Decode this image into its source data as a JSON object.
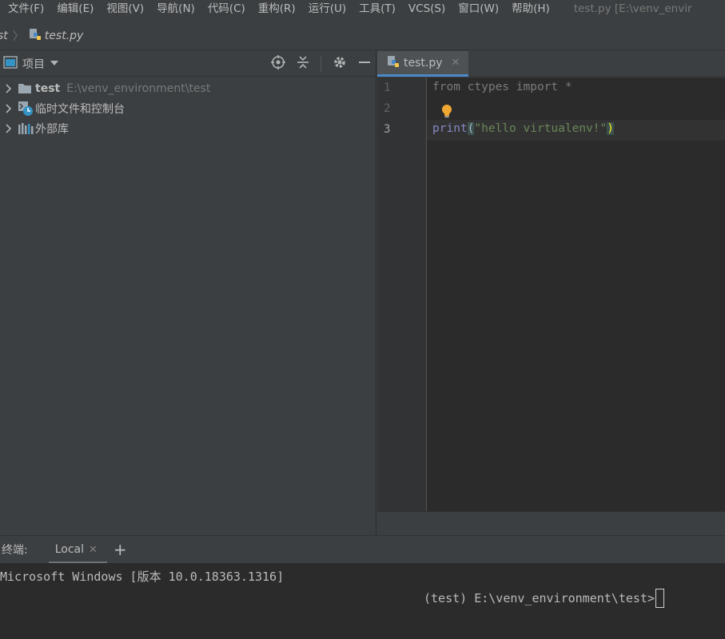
{
  "menubar": {
    "items": [
      "文件(F)",
      "编辑(E)",
      "视图(V)",
      "导航(N)",
      "代码(C)",
      "重构(R)",
      "运行(U)",
      "工具(T)",
      "VCS(S)",
      "窗口(W)",
      "帮助(H)"
    ],
    "window_title": "test.py [E:\\venv_envir"
  },
  "breadcrumb": {
    "project": "st",
    "file": "test.py"
  },
  "project_panel": {
    "title": "项目",
    "tree": [
      {
        "label": "test",
        "path": "E:\\venv_environment\\test",
        "icon": "folder-icon"
      },
      {
        "label": "临时文件和控制台",
        "icon": "scratches-icon"
      },
      {
        "label": "外部库",
        "icon": "library-icon"
      }
    ]
  },
  "editor": {
    "tab_label": "test.py",
    "line_numbers": [
      "1",
      "2",
      "3"
    ],
    "code": {
      "line1": "from ctypes import *",
      "line3_func": "print",
      "line3_open": "(",
      "line3_str": "\"hello virtualenv!\"",
      "line3_close": ")"
    }
  },
  "terminal": {
    "title": "终端:",
    "tab_label": "Local",
    "line1": "Microsoft Windows [版本 10.0.18363.1316]",
    "prompt": "(test) E:\\venv_environment\\test>"
  },
  "colors": {
    "background": "#3c3f41",
    "editor_bg": "#2b2b2b",
    "accent": "#4a88c7",
    "string": "#6a8759",
    "builtin": "#8888c6"
  }
}
